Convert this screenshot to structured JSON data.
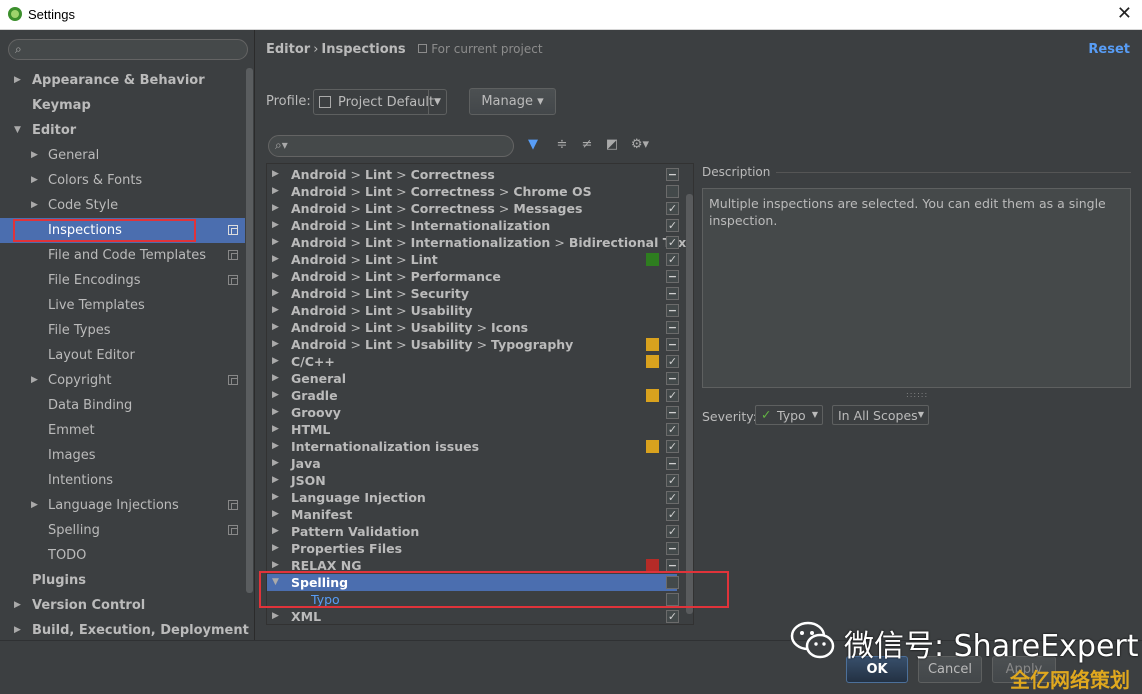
{
  "window": {
    "title": "Settings"
  },
  "sidebar": {
    "items": [
      {
        "label": "Appearance & Behavior",
        "level": 0,
        "arrow": "▶",
        "bold": true,
        "copy": false,
        "selected": false
      },
      {
        "label": "Keymap",
        "level": 0,
        "arrow": "",
        "bold": true,
        "copy": false,
        "selected": false
      },
      {
        "label": "Editor",
        "level": 0,
        "arrow": "▼",
        "bold": true,
        "copy": false,
        "selected": false
      },
      {
        "label": "General",
        "level": 1,
        "arrow": "▶",
        "bold": false,
        "copy": false,
        "selected": false
      },
      {
        "label": "Colors & Fonts",
        "level": 1,
        "arrow": "▶",
        "bold": false,
        "copy": false,
        "selected": false
      },
      {
        "label": "Code Style",
        "level": 1,
        "arrow": "▶",
        "bold": false,
        "copy": false,
        "selected": false
      },
      {
        "label": "Inspections",
        "level": 2,
        "arrow": "",
        "bold": false,
        "copy": true,
        "selected": true
      },
      {
        "label": "File and Code Templates",
        "level": 2,
        "arrow": "",
        "bold": false,
        "copy": true,
        "selected": false
      },
      {
        "label": "File Encodings",
        "level": 2,
        "arrow": "",
        "bold": false,
        "copy": true,
        "selected": false
      },
      {
        "label": "Live Templates",
        "level": 2,
        "arrow": "",
        "bold": false,
        "copy": false,
        "selected": false
      },
      {
        "label": "File Types",
        "level": 2,
        "arrow": "",
        "bold": false,
        "copy": false,
        "selected": false
      },
      {
        "label": "Layout Editor",
        "level": 2,
        "arrow": "",
        "bold": false,
        "copy": false,
        "selected": false
      },
      {
        "label": "Copyright",
        "level": 1,
        "arrow": "▶",
        "bold": false,
        "copy": true,
        "selected": false
      },
      {
        "label": "Data Binding",
        "level": 2,
        "arrow": "",
        "bold": false,
        "copy": false,
        "selected": false
      },
      {
        "label": "Emmet",
        "level": 2,
        "arrow": "",
        "bold": false,
        "copy": false,
        "selected": false
      },
      {
        "label": "Images",
        "level": 2,
        "arrow": "",
        "bold": false,
        "copy": false,
        "selected": false
      },
      {
        "label": "Intentions",
        "level": 2,
        "arrow": "",
        "bold": false,
        "copy": false,
        "selected": false
      },
      {
        "label": "Language Injections",
        "level": 1,
        "arrow": "▶",
        "bold": false,
        "copy": true,
        "selected": false
      },
      {
        "label": "Spelling",
        "level": 2,
        "arrow": "",
        "bold": false,
        "copy": true,
        "selected": false
      },
      {
        "label": "TODO",
        "level": 2,
        "arrow": "",
        "bold": false,
        "copy": false,
        "selected": false
      },
      {
        "label": "Plugins",
        "level": 0,
        "arrow": "",
        "bold": true,
        "copy": false,
        "selected": false
      },
      {
        "label": "Version Control",
        "level": 0,
        "arrow": "▶",
        "bold": true,
        "copy": false,
        "selected": false
      },
      {
        "label": "Build, Execution, Deployment",
        "level": 0,
        "arrow": "▶",
        "bold": true,
        "copy": false,
        "selected": false
      }
    ]
  },
  "breadcrumb": {
    "part1": "Editor",
    "sep": "›",
    "part2": "Inspections",
    "scope": "For current project"
  },
  "reset_label": "Reset",
  "profile": {
    "label": "Profile:",
    "value": "Project Default",
    "manage_label": "Manage ▾"
  },
  "toolbar_icons": [
    "filter-icon",
    "expand-all-icon",
    "collapse-all-icon",
    "reset-to-empty-icon",
    "settings-gear-icon"
  ],
  "tree": {
    "rows": [
      {
        "parts": [
          "Android",
          "Lint",
          "Correctness"
        ],
        "sev": "",
        "check": "−",
        "child": false,
        "selected": false,
        "arrow": "▶"
      },
      {
        "parts": [
          "Android",
          "Lint",
          "Correctness",
          "Chrome OS"
        ],
        "sev": "",
        "check": "",
        "child": false,
        "selected": false,
        "arrow": "▶"
      },
      {
        "parts": [
          "Android",
          "Lint",
          "Correctness",
          "Messages"
        ],
        "sev": "",
        "check": "✓",
        "child": false,
        "selected": false,
        "arrow": "▶"
      },
      {
        "parts": [
          "Android",
          "Lint",
          "Internationalization"
        ],
        "sev": "",
        "check": "✓",
        "child": false,
        "selected": false,
        "arrow": "▶"
      },
      {
        "parts": [
          "Android",
          "Lint",
          "Internationalization",
          "Bidirectional Tex"
        ],
        "sev": "",
        "check": "✓",
        "child": false,
        "selected": false,
        "arrow": "▶"
      },
      {
        "parts": [
          "Android",
          "Lint",
          "Lint"
        ],
        "sev": "#2e7d1f",
        "check": "✓",
        "child": false,
        "selected": false,
        "arrow": "▶"
      },
      {
        "parts": [
          "Android",
          "Lint",
          "Performance"
        ],
        "sev": "",
        "check": "−",
        "child": false,
        "selected": false,
        "arrow": "▶"
      },
      {
        "parts": [
          "Android",
          "Lint",
          "Security"
        ],
        "sev": "",
        "check": "−",
        "child": false,
        "selected": false,
        "arrow": "▶"
      },
      {
        "parts": [
          "Android",
          "Lint",
          "Usability"
        ],
        "sev": "",
        "check": "−",
        "child": false,
        "selected": false,
        "arrow": "▶"
      },
      {
        "parts": [
          "Android",
          "Lint",
          "Usability",
          "Icons"
        ],
        "sev": "",
        "check": "−",
        "child": false,
        "selected": false,
        "arrow": "▶"
      },
      {
        "parts": [
          "Android",
          "Lint",
          "Usability",
          "Typography"
        ],
        "sev": "#d9a21e",
        "check": "−",
        "child": false,
        "selected": false,
        "arrow": "▶"
      },
      {
        "parts": [
          "C/C++"
        ],
        "sev": "#d9a21e",
        "check": "✓",
        "child": false,
        "selected": false,
        "arrow": "▶"
      },
      {
        "parts": [
          "General"
        ],
        "sev": "",
        "check": "−",
        "child": false,
        "selected": false,
        "arrow": "▶"
      },
      {
        "parts": [
          "Gradle"
        ],
        "sev": "#d9a21e",
        "check": "✓",
        "child": false,
        "selected": false,
        "arrow": "▶"
      },
      {
        "parts": [
          "Groovy"
        ],
        "sev": "",
        "check": "−",
        "child": false,
        "selected": false,
        "arrow": "▶"
      },
      {
        "parts": [
          "HTML"
        ],
        "sev": "",
        "check": "✓",
        "child": false,
        "selected": false,
        "arrow": "▶"
      },
      {
        "parts": [
          "Internationalization issues"
        ],
        "sev": "#d9a21e",
        "check": "✓",
        "child": false,
        "selected": false,
        "arrow": "▶"
      },
      {
        "parts": [
          "Java"
        ],
        "sev": "",
        "check": "−",
        "child": false,
        "selected": false,
        "arrow": "▶"
      },
      {
        "parts": [
          "JSON"
        ],
        "sev": "",
        "check": "✓",
        "child": false,
        "selected": false,
        "arrow": "▶"
      },
      {
        "parts": [
          "Language Injection"
        ],
        "sev": "",
        "check": "✓",
        "child": false,
        "selected": false,
        "arrow": "▶"
      },
      {
        "parts": [
          "Manifest"
        ],
        "sev": "",
        "check": "✓",
        "child": false,
        "selected": false,
        "arrow": "▶"
      },
      {
        "parts": [
          "Pattern Validation"
        ],
        "sev": "",
        "check": "✓",
        "child": false,
        "selected": false,
        "arrow": "▶"
      },
      {
        "parts": [
          "Properties Files"
        ],
        "sev": "",
        "check": "−",
        "child": false,
        "selected": false,
        "arrow": "▶"
      },
      {
        "parts": [
          "RELAX NG"
        ],
        "sev": "#b52b27",
        "check": "−",
        "child": false,
        "selected": false,
        "arrow": "▶"
      },
      {
        "parts": [
          "Spelling"
        ],
        "sev": "",
        "check": "",
        "child": false,
        "selected": true,
        "arrow": "▼"
      },
      {
        "parts": [
          "Typo"
        ],
        "sev": "",
        "check": "",
        "child": true,
        "selected": false,
        "arrow": ""
      },
      {
        "parts": [
          "XML"
        ],
        "sev": "",
        "check": "✓",
        "child": false,
        "selected": false,
        "arrow": "▶"
      }
    ]
  },
  "description": {
    "label": "Description",
    "text": "Multiple inspections are selected. You can edit them as a single inspection."
  },
  "severity": {
    "label": "Severity:",
    "check": "✓",
    "value": "Typo",
    "scope": "In All Scopes"
  },
  "buttons": {
    "ok": "OK",
    "cancel": "Cancel",
    "apply": "Apply"
  },
  "watermark": {
    "text": "微信号: ShareExpert",
    "text2": "全亿网络策划"
  }
}
